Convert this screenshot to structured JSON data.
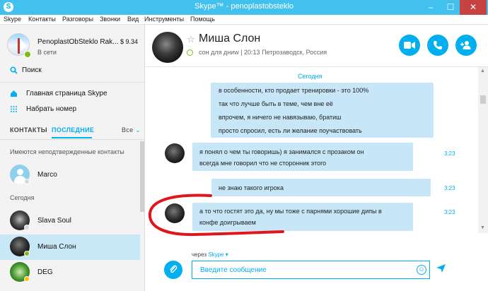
{
  "window": {
    "title": "Skype™ - penoplastobsteklo",
    "minimize_glyph": "–",
    "maximize_glyph": "☐",
    "close_glyph": "✕"
  },
  "menu": [
    "Skype",
    "Контакты",
    "Разговоры",
    "Звонки",
    "Вид",
    "Инструменты",
    "Помощь"
  ],
  "profile": {
    "name": "PenoplastObSteklo Rak...",
    "status": "В сети",
    "balance": "$ 9.34"
  },
  "nav": {
    "search_label": "Поиск",
    "home_label": "Главная страница Skype",
    "dial_label": "Набрать номер"
  },
  "tabs": {
    "contacts": "КОНТАКТЫ",
    "recent": "ПОСЛЕДНИЕ",
    "filter": "Все",
    "filter_chevron": "⌄"
  },
  "sections": {
    "unconfirmed": "Имеются неподтвержденные контакты",
    "today": "Сегодня"
  },
  "contacts": [
    {
      "name": "Marco",
      "presence": "unknown"
    },
    {
      "name": "Slava Soul",
      "presence": "unknown"
    },
    {
      "name": "Миша Слон",
      "presence": "online",
      "selected": true
    },
    {
      "name": "DEG",
      "presence": "away"
    }
  ],
  "chat": {
    "title": "Миша Слон",
    "subtitle": "сон для дниw | 20:13 Петрозаводск, Россия",
    "day_label": "Сегодня",
    "messages": [
      {
        "lines": [
          "в особенности, кто продает тренировки - это 100%",
          "так что лучше быть в теме, чем вне её",
          "впрочем, я ничего не навязываю, братиш",
          "просто спросил, есть ли желание поучаствовать"
        ],
        "outgoing": true
      },
      {
        "lines": [
          "я понял о чем ты говоришь) я занимался с прозаком он",
          "всегда мне говорил что не сторонник этого"
        ],
        "time": "3:23",
        "outgoing": false
      },
      {
        "lines": [
          "не знаю такого игрока"
        ],
        "time": "3:23",
        "outgoing": true
      },
      {
        "lines": [
          "а то что гостят это да, ну мы тоже с парнями хорошие дипы в",
          "конфе доигрываем"
        ],
        "time": "3:23",
        "outgoing": false
      }
    ]
  },
  "compose": {
    "via_prefix": "через",
    "via_service": "Skype ▾",
    "placeholder": "Введите сообщение"
  },
  "colors": {
    "accent": "#00aff0",
    "titlebar": "#42c0ee",
    "bubble": "#c7e6f8",
    "selected_row": "#c8e8f8",
    "online": "#7dbb19",
    "away": "#ffc000",
    "close_button": "#c74343",
    "annotation": "#e0161d"
  },
  "icons": {
    "search": "search-icon",
    "home": "home-icon",
    "dialpad": "dialpad-icon",
    "video_call": "video-camera-icon",
    "audio_call": "phone-icon",
    "add_person": "add-person-icon",
    "attach": "paperclip-icon",
    "emoji": "emoticon-icon",
    "send": "send-icon",
    "favorite": "star-icon"
  }
}
